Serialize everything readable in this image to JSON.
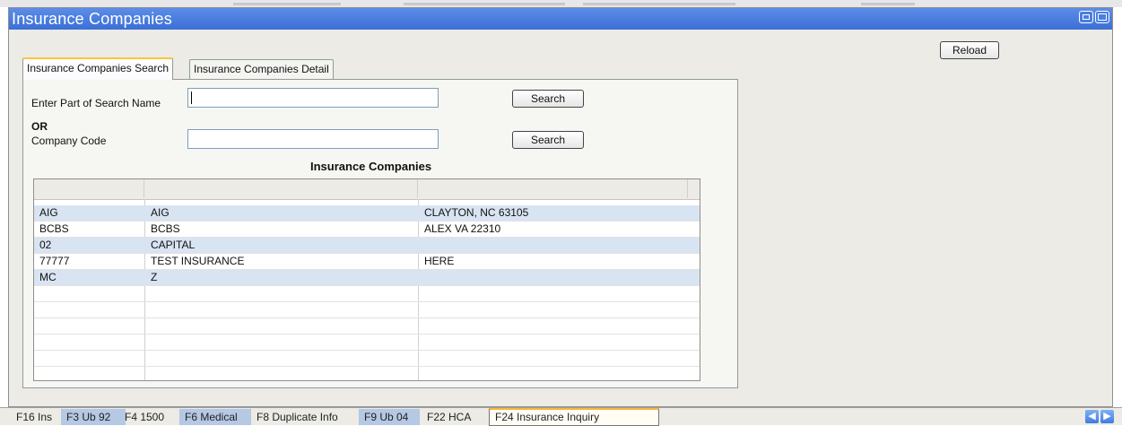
{
  "window": {
    "title": "Insurance Companies"
  },
  "toolbar": {
    "reload_label": "Reload"
  },
  "tabs": [
    {
      "label": "Insurance Companies Search",
      "active": true
    },
    {
      "label": "Insurance Companies Detail",
      "active": false
    }
  ],
  "search": {
    "name_label": "Enter Part of Search Name",
    "name_value": "",
    "or_label": "OR",
    "code_label": "Company Code",
    "code_value": "",
    "search_button_label": "Search"
  },
  "table": {
    "title": "Insurance Companies",
    "rows": [
      [
        "AIG",
        "AIG",
        "CLAYTON, NC 63105"
      ],
      [
        "BCBS",
        "BCBS",
        "ALEX VA 22310"
      ],
      [
        "02",
        "CAPITAL",
        ""
      ],
      [
        "77777",
        "TEST INSURANCE",
        "HERE"
      ],
      [
        "MC",
        "Z",
        ""
      ]
    ]
  },
  "bottom_tabs": [
    {
      "label": "F16 Ins",
      "style": "plain"
    },
    {
      "label": "F3 Ub 92",
      "style": "shade"
    },
    {
      "label": "F4 1500",
      "style": "plain"
    },
    {
      "label": "F6 Medical",
      "style": "shade"
    },
    {
      "label": "F8 Duplicate Info",
      "style": "plain"
    },
    {
      "label": "F9 Ub 04",
      "style": "shade"
    },
    {
      "label": "F22 HCA",
      "style": "plain"
    },
    {
      "label": "F24 Insurance Inquiry",
      "style": "active"
    }
  ],
  "colors": {
    "titlebar": "#3b6fd6",
    "selected_row": "#d9e4f2",
    "active_tab_accent": "#ffc43a"
  },
  "icons": {
    "restore": "restore-icon",
    "maximize": "maximize-icon",
    "back": "arrow-left-icon",
    "forward": "arrow-right-icon"
  }
}
